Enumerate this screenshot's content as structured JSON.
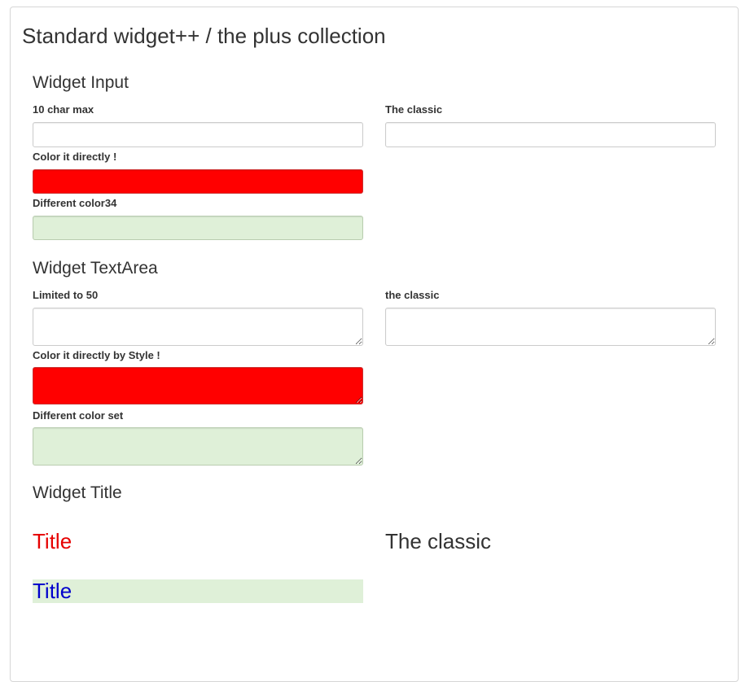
{
  "page": {
    "title": "Standard widget++ / the plus collection"
  },
  "input_section": {
    "heading": "Widget Input",
    "fields": [
      {
        "label": "10 char max",
        "value": ""
      },
      {
        "label": "The classic",
        "value": ""
      },
      {
        "label": "Color it directly !",
        "value": "",
        "color": "#ff0000"
      },
      {
        "label": "Different color34",
        "value": "",
        "color": "#dff0d8"
      }
    ]
  },
  "textarea_section": {
    "heading": "Widget TextArea",
    "fields": [
      {
        "label": "Limited to 50",
        "value": ""
      },
      {
        "label": "the classic",
        "value": ""
      },
      {
        "label": "Color it directly by Style !",
        "value": "",
        "color": "#ff0000"
      },
      {
        "label": "Different color set",
        "value": "",
        "color": "#dff0d8"
      }
    ]
  },
  "title_section": {
    "heading": "Widget Title",
    "titles": [
      {
        "text": "Title",
        "color": "#e60000"
      },
      {
        "text": "The classic",
        "color": "#333333"
      },
      {
        "text": "Title",
        "color": "#0000cc",
        "background": "#dff0d8"
      }
    ]
  }
}
